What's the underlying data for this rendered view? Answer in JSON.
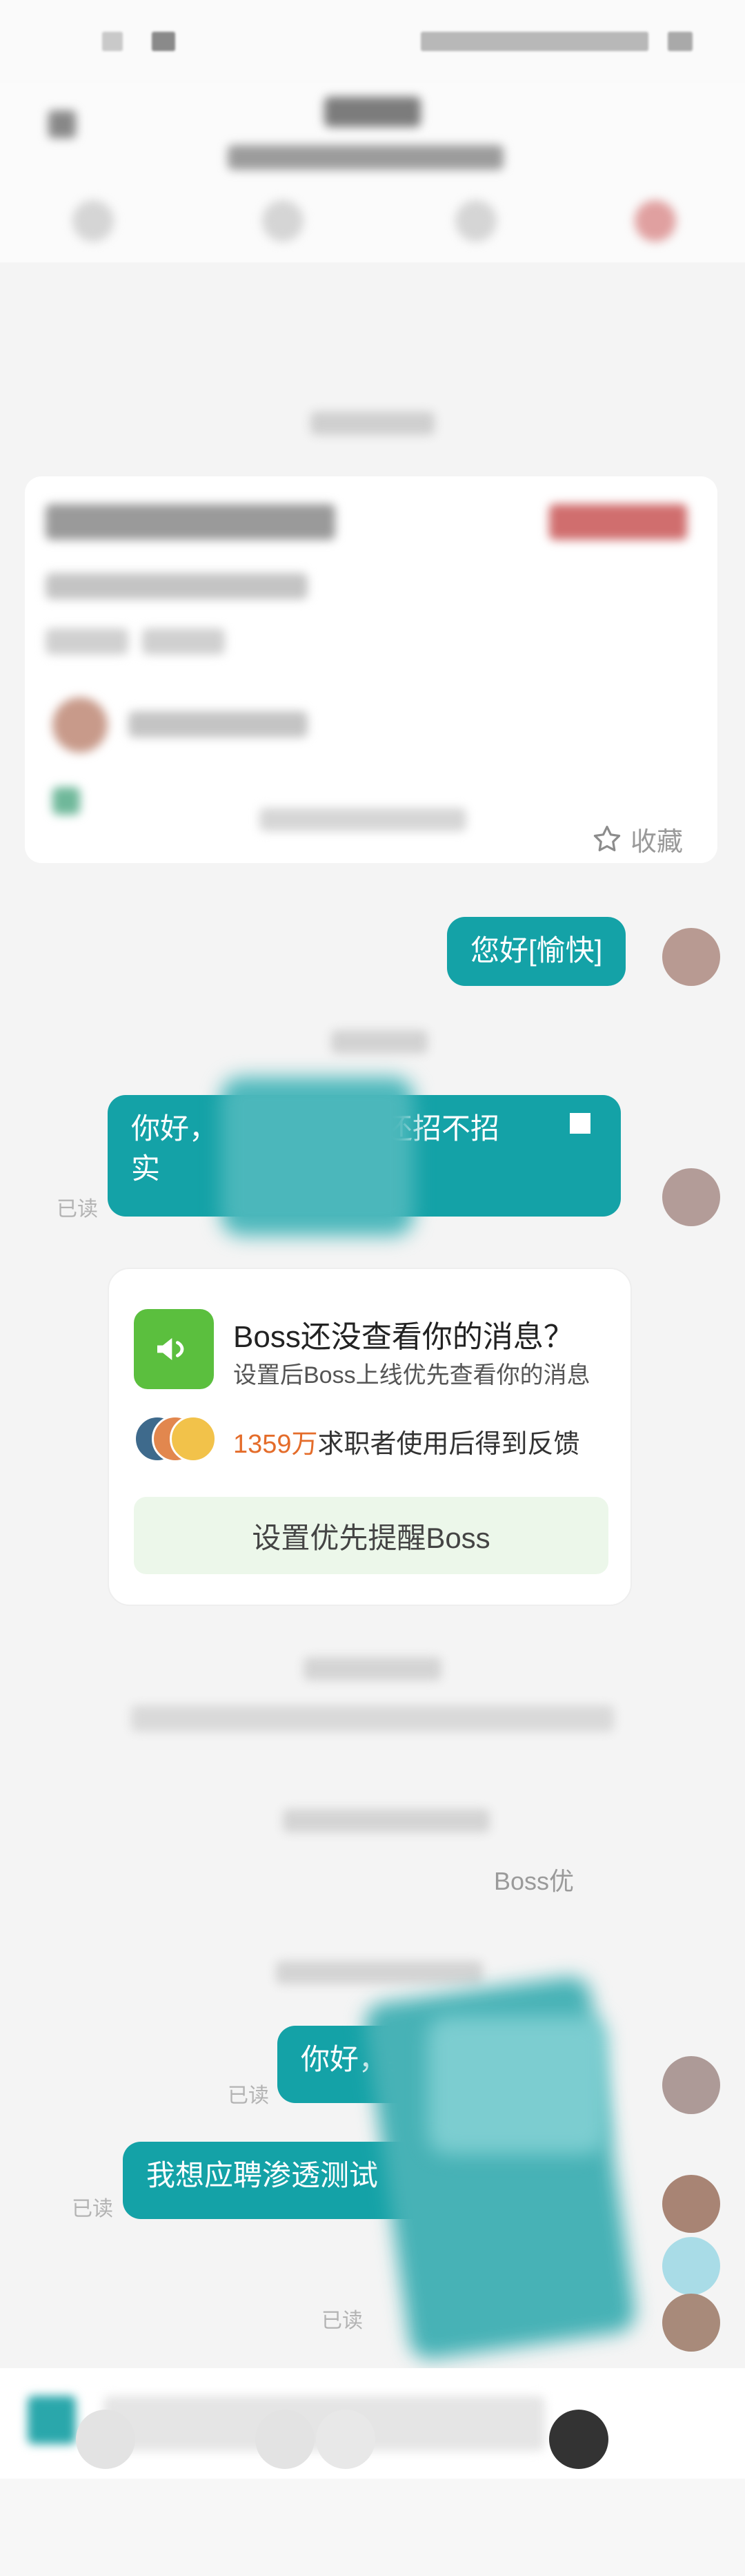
{
  "job_card": {
    "favorite_label": "收藏"
  },
  "messages": [
    {
      "id": "m1",
      "direction": "out",
      "text": "您好[愉快]",
      "read": ""
    },
    {
      "id": "m2",
      "direction": "out",
      "text_line1": "你好，",
      "text_line1_tail": "还招不招",
      "text_line2": "实",
      "read": "已读"
    },
    {
      "id": "m3",
      "direction": "out",
      "text": "你好，我是",
      "read": "已读"
    },
    {
      "id": "m4",
      "direction": "out",
      "text": "我想应聘渗透测试",
      "read": "已读"
    },
    {
      "id": "m5",
      "direction": "out",
      "text": "",
      "read": "已读"
    }
  ],
  "reminder": {
    "title": "Boss还没查看你的消息？",
    "subtitle": "设置后Boss上线优先查看你的消息",
    "count": "1359万",
    "count_suffix": "求职者使用后得到反馈",
    "button": "设置优先提醒Boss"
  },
  "system_tip": {
    "text": "Boss优"
  },
  "icons": {
    "favorite": "star-outline-icon",
    "megaphone": "megaphone-icon"
  },
  "colors": {
    "bubble": "#14a2a7",
    "accent_green": "#5bbf3e",
    "count_orange": "#e46c2a"
  }
}
